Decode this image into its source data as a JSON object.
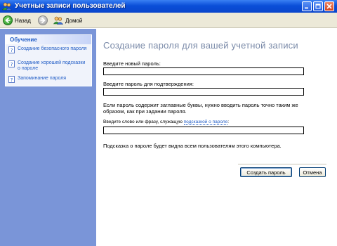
{
  "window": {
    "title": "Учетные записи пользователей",
    "minimize_icon": "minimize-icon",
    "maximize_icon": "maximize-icon",
    "close_icon": "close-icon"
  },
  "toolbar": {
    "back_label": "Назад",
    "home_label": "Домой"
  },
  "sidebar": {
    "section_title": "Обучение",
    "items": [
      {
        "label": "Создание безопасного пароля",
        "icon": "help-icon"
      },
      {
        "label": "Создание хорошей подсказки о пароле",
        "icon": "help-icon"
      },
      {
        "label": "Запоминание пароля",
        "icon": "help-icon"
      }
    ]
  },
  "form": {
    "title": "Создание пароля для вашей учетной записи",
    "new_password_label": "Введите новый пароль:",
    "new_password_value": "",
    "confirm_label": "Введите пароль для подтверждения:",
    "confirm_value": "",
    "case_note": "Если пароль содержит заглавные буквы, нужно вводить пароль точно таким же образом, как при задании пароля.",
    "hint_label_prefix": "Введите слово или фразу, служащую ",
    "hint_link": "подсказкой о пароле",
    "hint_label_suffix": ":",
    "hint_value": "",
    "hint_note": "Подсказка о пароле будет видна всем пользователям этого компьютера.",
    "create_button": "Создать пароль",
    "cancel_button": "Отмена"
  }
}
